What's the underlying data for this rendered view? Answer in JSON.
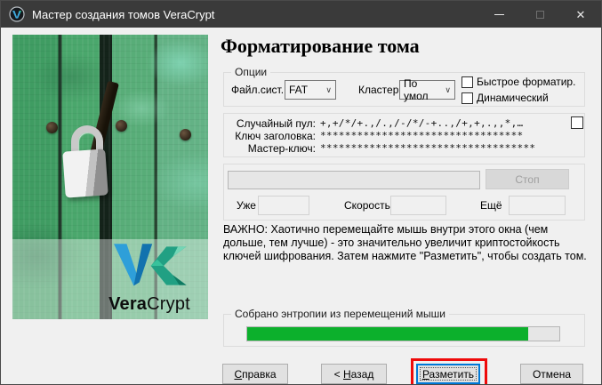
{
  "window": {
    "title": "Мастер создания томов VeraCrypt",
    "close_glyph": "✕"
  },
  "page": {
    "heading": "Форматирование тома"
  },
  "options": {
    "group_label": "Опции",
    "filesystem_label": "Файл.сист.",
    "filesystem_value": "FAT",
    "cluster_label": "Кластер",
    "cluster_value": "По умол",
    "chevron": "∨",
    "quick_format_label": "Быстрое форматир.",
    "dynamic_label": "Динамический"
  },
  "random_pool": {
    "pool_label": "Случайный пул:",
    "pool_value": "+,+/*/+.,/.,/-/*/-+..,/+,+,.,,*,…",
    "header_key_label": "Ключ заголовка:",
    "header_key_value": "*********************************",
    "master_key_label": "Мастер-ключ:",
    "master_key_value": "***********************************"
  },
  "progress": {
    "percent": 0,
    "stop_label": "Стоп",
    "done_label": "Уже",
    "done_value": "",
    "speed_label": "Скорость",
    "speed_value": "",
    "left_label": "Ещё",
    "left_value": ""
  },
  "notice": "ВАЖНО: Хаотично перемещайте мышь внутри этого окна (чем дольше, тем лучше) - это значительно увеличит криптостойкость ключей шифрования. Затем нажмите \"Разметить\", чтобы создать том.",
  "entropy": {
    "group_label": "Собрано энтропии из перемещений мыши",
    "percent": 90,
    "bar_color": "#0cb02c"
  },
  "footer": {
    "help": {
      "accel": "С",
      "rest": "правка"
    },
    "back": {
      "pre": "< ",
      "accel": "Н",
      "rest": "азад"
    },
    "format": {
      "accel": "Р",
      "rest": "азметить"
    },
    "cancel_label": "Отмена"
  },
  "branding": {
    "logo_bold": "Vera",
    "logo_regular": "Crypt"
  }
}
